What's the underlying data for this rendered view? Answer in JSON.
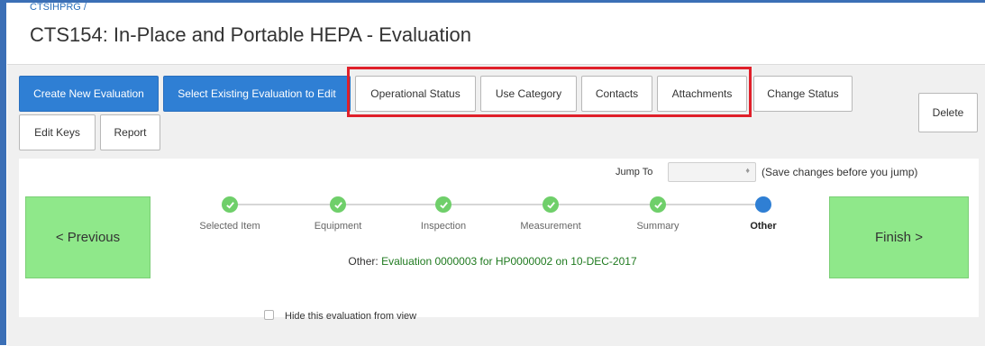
{
  "breadcrumb": "CTSIHPRG /",
  "page_title": "CTS154: In-Place and Portable HEPA - Evaluation",
  "toolbar": {
    "create_new": "Create New Evaluation",
    "select_existing": "Select Existing Evaluation to Edit",
    "operational_status": "Operational Status",
    "use_category": "Use Category",
    "contacts": "Contacts",
    "attachments": "Attachments",
    "change_status": "Change Status",
    "delete": "Delete",
    "edit_keys": "Edit Keys",
    "report": "Report"
  },
  "jump": {
    "label": "Jump To",
    "selected": "",
    "note": "(Save changes before you jump)"
  },
  "wizard": {
    "previous": "< Previous",
    "finish": "Finish >",
    "steps": [
      {
        "label": "Selected Item",
        "state": "done"
      },
      {
        "label": "Equipment",
        "state": "done"
      },
      {
        "label": "Inspection",
        "state": "done"
      },
      {
        "label": "Measurement",
        "state": "done"
      },
      {
        "label": "Summary",
        "state": "done"
      },
      {
        "label": "Other",
        "state": "current"
      }
    ],
    "status_prefix": "Other:",
    "status_detail": "Evaluation 0000003 for HP0000002 on 10-DEC-2017"
  },
  "hide_option": {
    "label": "Hide this evaluation from view",
    "checked": false
  },
  "colors": {
    "primary": "#2f7fd4",
    "done_step": "#6fcf6a",
    "nav_green": "#8fe88a",
    "highlight": "#e0202a",
    "status_detail": "#1f7a1f"
  }
}
